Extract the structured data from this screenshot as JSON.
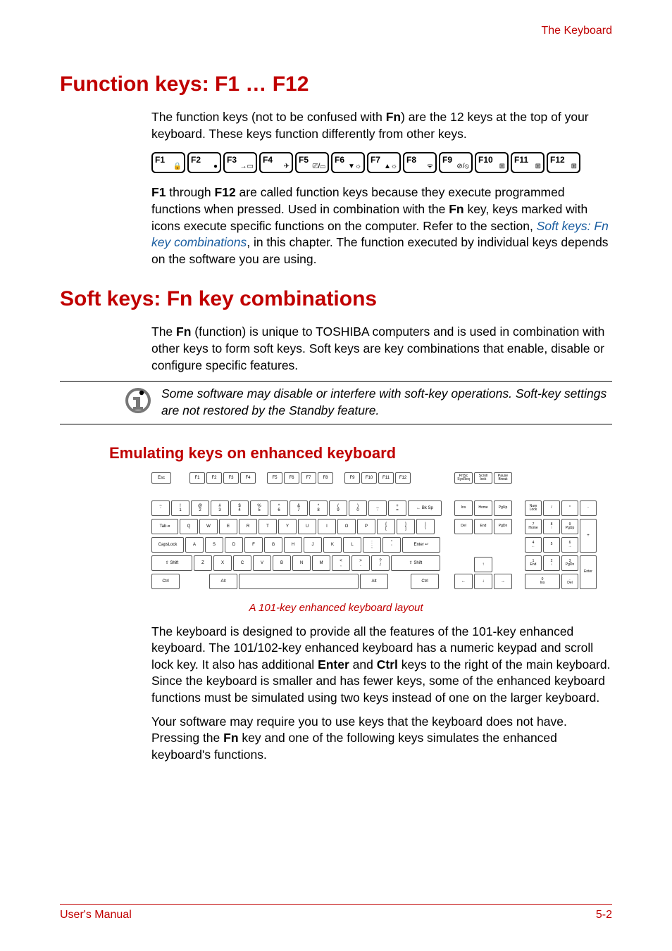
{
  "header": {
    "running_title": "The Keyboard"
  },
  "section1": {
    "title": "Function keys: F1 … F12",
    "p1_a": "The function keys (not to be confused with ",
    "p1_fn": "Fn",
    "p1_b": ") are the 12 keys at the top of your keyboard. These keys function differently from other keys.",
    "fkeys": [
      "F1",
      "F2",
      "F3",
      "F4",
      "F5",
      "F6",
      "F7",
      "F8",
      "F9",
      "F10",
      "F11",
      "F12"
    ],
    "fkey_icons": [
      "🔒",
      "●",
      "→▭",
      "✈",
      "⎚/▭",
      "▼☼",
      "▲☼",
      "ᯤ",
      "⊘/⦸",
      "⊞",
      "⊞",
      "⊞"
    ],
    "p2_f1": "F1",
    "p2_a": " through ",
    "p2_f12": "F12",
    "p2_b": " are called function keys because they execute programmed functions when pressed. Used in combination with the ",
    "p2_fn": "Fn",
    "p2_c": " key, keys marked with icons execute specific functions on the computer. Refer to the section, ",
    "p2_link": "Soft keys: Fn key combinations",
    "p2_d": ", in this chapter. The function executed by individual keys depends on the software you are using."
  },
  "section2": {
    "title": "Soft keys: Fn key combinations",
    "p1_a": "The ",
    "p1_fn": "Fn",
    "p1_b": " (function) is unique to TOSHIBA computers and is used in combination with other keys to form soft keys. Soft keys are key combinations that enable, disable or configure specific features.",
    "note": "Some software may disable or interfere with soft-key operations. Soft-key settings are not restored by the Standby feature.",
    "subtitle": "Emulating keys on enhanced keyboard",
    "caption": "A 101-key enhanced keyboard layout",
    "p2_a": "The keyboard is designed to provide all the features of the 101-key enhanced keyboard. The 101/102-key enhanced keyboard has a numeric keypad and scroll lock key. It also has additional ",
    "p2_enter": "Enter",
    "p2_b": " and ",
    "p2_ctrl": "Ctrl",
    "p2_c": " keys to the right of the main keyboard. Since the keyboard is smaller and has fewer keys, some of the enhanced keyboard functions must be simulated using two keys instead of one on the larger keyboard.",
    "p3_a": "Your software may require you to use keys that the keyboard does not have. Pressing the ",
    "p3_fn": "Fn",
    "p3_b": " key and one of the following keys simulates the enhanced keyboard's functions."
  },
  "kbd": {
    "frow": [
      "Esc",
      "F1",
      "F2",
      "F3",
      "F4",
      "F5",
      "F6",
      "F7",
      "F8",
      "F9",
      "F10",
      "F11",
      "F12"
    ],
    "top_right": [
      "PrtSc\nSysReq",
      "Scroll\nlock",
      "Pause\nBreak"
    ],
    "num_row": [
      "~\n`",
      "!\n1",
      "@\n2",
      "#\n3",
      "$\n4",
      "%\n5",
      "^\n6",
      "&\n7",
      "*\n8",
      "(\n9",
      ")\n0",
      "_\n-",
      "+\n=",
      "←  Bk Sp"
    ],
    "q_row": [
      "Tab⇥",
      "Q",
      "W",
      "E",
      "R",
      "T",
      "Y",
      "U",
      "I",
      "O",
      "P",
      "{\n[",
      "}\n]",
      "|\n\\"
    ],
    "a_row": [
      "CapsLock",
      "A",
      "S",
      "D",
      "F",
      "G",
      "H",
      "J",
      "K",
      "L",
      ":\n;",
      "\"\n'",
      "Enter  ↵"
    ],
    "z_row": [
      "⇧ Shift",
      "Z",
      "X",
      "C",
      "V",
      "B",
      "N",
      "M",
      "<\n,",
      ">\n.",
      "?\n/",
      "⇧ Shift"
    ],
    "bottom": [
      "Ctrl",
      "Alt",
      " ",
      "Alt",
      "Ctrl"
    ],
    "nav1": [
      "Ins",
      "Home",
      "PgUp"
    ],
    "nav2": [
      "Del",
      "End",
      "PgDn"
    ],
    "arrows": [
      "↑",
      "←",
      "↓",
      "→"
    ],
    "numpad": [
      [
        "Num\nLock",
        "/",
        "*",
        "-"
      ],
      [
        "7\nHome",
        "8\n↑",
        "9\nPgUp"
      ],
      [
        "4\n←",
        "5",
        "6\n→"
      ],
      [
        "1\nEnd",
        "2\n↓",
        "3\nPgDn"
      ],
      [
        "0\nIns",
        ".\nDel"
      ]
    ],
    "numpad_plus": "+",
    "numpad_enter": "Enter"
  },
  "footer": {
    "left": "User's Manual",
    "right": "5-2"
  }
}
